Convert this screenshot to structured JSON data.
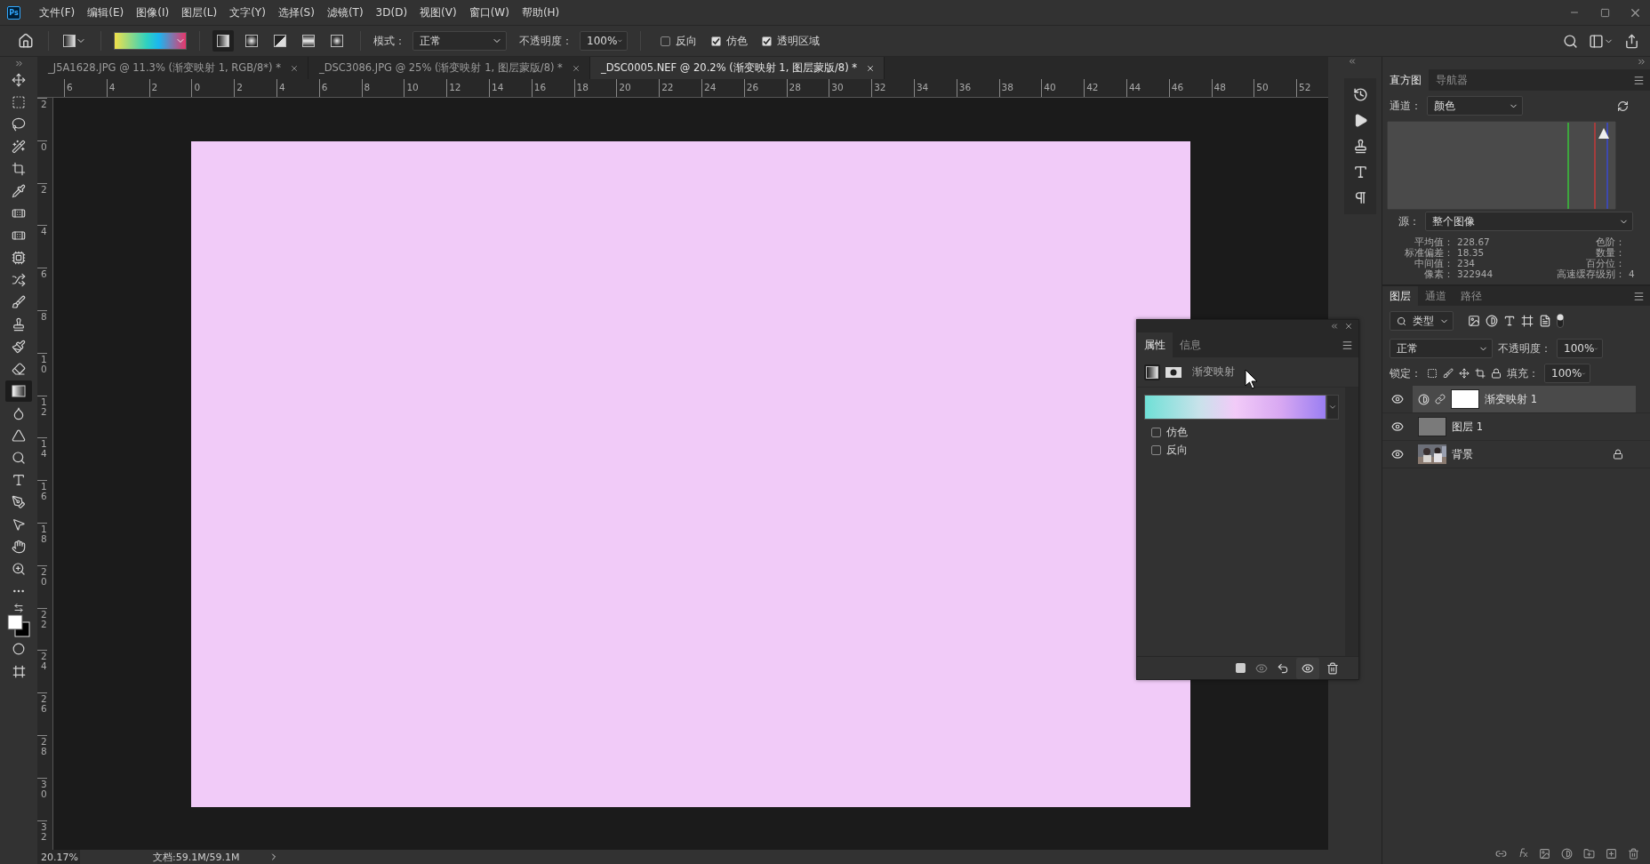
{
  "app_logo": "Ps",
  "menu": [
    "文件(F)",
    "编辑(E)",
    "图像(I)",
    "图层(L)",
    "文字(Y)",
    "选择(S)",
    "滤镜(T)",
    "3D(D)",
    "视图(V)",
    "窗口(W)",
    "帮助(H)"
  ],
  "options_bar": {
    "gradient_types": [
      {
        "kind": "linear",
        "selected": true
      },
      {
        "kind": "radial",
        "selected": false
      },
      {
        "kind": "angle",
        "selected": false
      },
      {
        "kind": "reflected",
        "selected": false
      },
      {
        "kind": "diamond",
        "selected": false
      }
    ],
    "mode_label": "模式：",
    "mode": "正常",
    "opacity_label": "不透明度：",
    "opacity": "100%",
    "checkboxes": [
      {
        "label": "反向",
        "checked": false
      },
      {
        "label": "仿色",
        "checked": true
      },
      {
        "label": "透明区域",
        "checked": true
      }
    ]
  },
  "tabs": [
    {
      "label": "_J5A1628.JPG @ 11.3% (渐变映射 1, RGB/8*) *",
      "selected": false
    },
    {
      "label": "_DSC3086.JPG @ 25% (渐变映射 1, 图层蒙版/8) *",
      "selected": false
    },
    {
      "label": "_DSC0005.NEF @ 20.2% (渐变映射 1, 图层蒙版/8) *",
      "selected": true
    }
  ],
  "ruler": {
    "horizontal": [
      "6",
      "4",
      "2",
      "0",
      "2",
      "4",
      "6",
      "8",
      "10",
      "12",
      "14",
      "16",
      "18",
      "20",
      "22",
      "24",
      "26",
      "28",
      "30",
      "32",
      "34",
      "36",
      "38",
      "40",
      "42",
      "44",
      "46",
      "48",
      "50",
      "52"
    ],
    "vertical": [
      "2",
      "0",
      "2",
      "4",
      "6",
      "8",
      "10",
      "12",
      "14",
      "16",
      "18",
      "20",
      "22",
      "24",
      "26",
      "28",
      "30",
      "32"
    ]
  },
  "tools": [
    {
      "kind": "move",
      "selected": false
    },
    {
      "kind": "marquee",
      "selected": false
    },
    {
      "kind": "lasso",
      "selected": false
    },
    {
      "kind": "wand",
      "selected": false
    },
    {
      "kind": "crop",
      "selected": false
    },
    {
      "kind": "eyedropper",
      "selected": false
    },
    {
      "kind": "spot-healing",
      "selected": false
    },
    {
      "kind": "healing",
      "selected": false
    },
    {
      "kind": "patch",
      "selected": false
    },
    {
      "kind": "content-move",
      "selected": false
    },
    {
      "kind": "brush",
      "selected": false
    },
    {
      "kind": "stamp",
      "selected": false
    },
    {
      "kind": "history-brush",
      "selected": false
    },
    {
      "kind": "eraser",
      "selected": false
    },
    {
      "kind": "gradient",
      "selected": true
    },
    {
      "kind": "smudge",
      "selected": false
    },
    {
      "kind": "blur",
      "selected": false
    },
    {
      "kind": "dodge",
      "selected": false
    },
    {
      "kind": "type",
      "selected": false
    },
    {
      "kind": "pen",
      "selected": false
    },
    {
      "kind": "path-select",
      "selected": false
    },
    {
      "kind": "hand",
      "selected": false
    },
    {
      "kind": "zoom",
      "selected": false
    },
    {
      "kind": "more",
      "selected": false
    }
  ],
  "status_bar": {
    "zoom": "20.17%",
    "document": "文档:59.1M/59.1M"
  },
  "histogram_panel": {
    "tabs": [
      {
        "label": "直方图",
        "selected": true
      },
      {
        "label": "导航器",
        "selected": false
      }
    ],
    "channel_label": "通道：",
    "channel": "颜色",
    "source_label": "源：",
    "source": "整个图像",
    "stats_left": [
      {
        "label": "平均值：",
        "value": "228.67"
      },
      {
        "label": "标准偏差：",
        "value": "18.35"
      },
      {
        "label": "中间值：",
        "value": "234"
      },
      {
        "label": "像素：",
        "value": "322944"
      }
    ],
    "stats_right": [
      {
        "label": "色阶："
      },
      {
        "label": "数量："
      },
      {
        "label": "百分位："
      },
      {
        "label": "高速缓存级别：",
        "value": "4"
      }
    ]
  },
  "layers_panel": {
    "tabs": [
      {
        "label": "图层",
        "selected": true
      },
      {
        "label": "通道",
        "selected": false
      },
      {
        "label": "路径",
        "selected": false
      }
    ],
    "filter": "类型",
    "blend_mode": "正常",
    "opacity_label": "不透明度：",
    "opacity": "100%",
    "lock_label": "锁定：",
    "fill_label": "填充：",
    "fill": "100%",
    "layers": [
      {
        "name": "渐变映射 1",
        "kind": "adjustment",
        "selected": true,
        "visible": true,
        "locked": false
      },
      {
        "name": "图层 1",
        "kind": "fill",
        "selected": false,
        "visible": true,
        "locked": false
      },
      {
        "name": "背景",
        "selected": false,
        "visible": true,
        "locked": true
      }
    ]
  },
  "properties_panel": {
    "tabs": [
      {
        "label": "属性",
        "selected": true
      },
      {
        "label": "信息",
        "selected": false
      }
    ],
    "title": "渐变映射",
    "checkboxes": [
      {
        "label": "仿色",
        "checked": false
      },
      {
        "label": "反向",
        "checked": false
      }
    ]
  }
}
